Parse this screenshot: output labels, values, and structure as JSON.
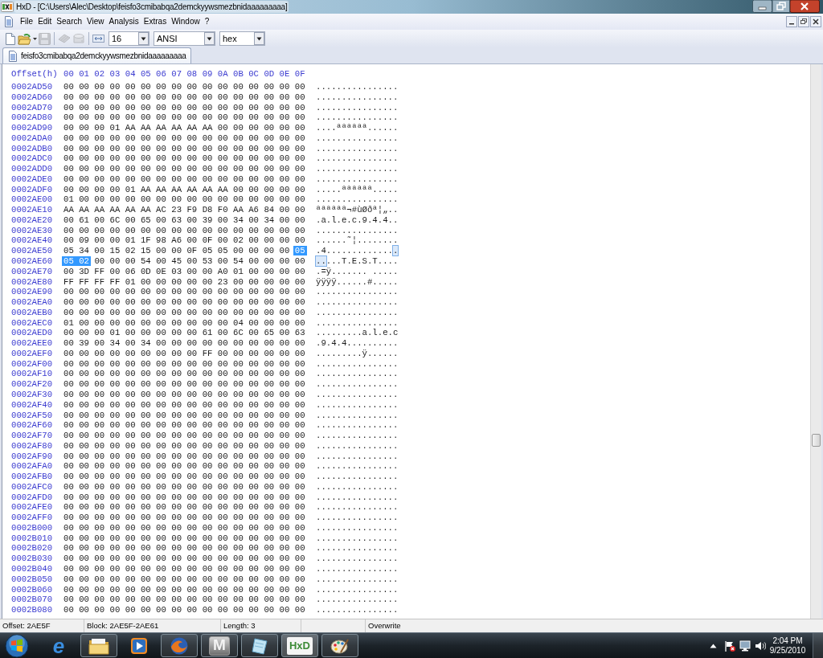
{
  "window": {
    "title": "HxD - [C:\\Users\\Alec\\Desktop\\feisfo3cmibabqa2demckyywsmezbnidaaaaaaaaa]"
  },
  "menu": [
    "File",
    "Edit",
    "Search",
    "View",
    "Analysis",
    "Extras",
    "Window",
    "?"
  ],
  "toolbar": {
    "groups": [
      [
        {
          "kind": "new",
          "disabled": false
        },
        {
          "kind": "open",
          "disabled": false
        },
        {
          "kind": "save",
          "disabled": true
        }
      ],
      [
        {
          "kind": "chip",
          "disabled": true
        },
        {
          "kind": "drive",
          "disabled": true
        }
      ],
      [
        {
          "kind": "row_width",
          "disabled": false
        }
      ]
    ],
    "dropdowns": [
      {
        "value": "16"
      },
      {
        "value": "ANSI"
      },
      {
        "value": "hex"
      }
    ]
  },
  "tabs": [
    {
      "label": "feisfo3cmibabqa2demckyywsmezbnidaaaaaaaaa",
      "selected": true
    }
  ],
  "hex_view": {
    "header": {
      "offset": "Offset(h)",
      "columns": "00 01 02 03 04 05 06 07 08 09 0A 0B 0C 0D 0E 0F"
    },
    "rows": [
      {
        "offset": "0002AD50",
        "hex": [
          {
            "text": "00 00 00 00 00 00 00 00 00 00 00 00 00 00 00 00",
            "selected": false
          }
        ],
        "ascii": [
          {
            "text": "................",
            "selected": false
          }
        ]
      },
      {
        "offset": "0002AD60",
        "hex": [
          {
            "text": "00 00 00 00 00 00 00 00 00 00 00 00 00 00 00 00",
            "selected": false
          }
        ],
        "ascii": [
          {
            "text": "................",
            "selected": false
          }
        ]
      },
      {
        "offset": "0002AD70",
        "hex": [
          {
            "text": "00 00 00 00 00 00 00 00 00 00 00 00 00 00 00 00",
            "selected": false
          }
        ],
        "ascii": [
          {
            "text": "................",
            "selected": false
          }
        ]
      },
      {
        "offset": "0002AD80",
        "hex": [
          {
            "text": "00 00 00 00 00 00 00 00 00 00 00 00 00 00 00 00",
            "selected": false
          }
        ],
        "ascii": [
          {
            "text": "................",
            "selected": false
          }
        ]
      },
      {
        "offset": "0002AD90",
        "hex": [
          {
            "text": "00 00 00 01 AA AA AA AA AA AA 00 00 00 00 00 00",
            "selected": false
          }
        ],
        "ascii": [
          {
            "text": "....ªªªªªª......",
            "selected": false
          }
        ]
      },
      {
        "offset": "0002ADA0",
        "hex": [
          {
            "text": "00 00 00 00 00 00 00 00 00 00 00 00 00 00 00 00",
            "selected": false
          }
        ],
        "ascii": [
          {
            "text": "................",
            "selected": false
          }
        ]
      },
      {
        "offset": "0002ADB0",
        "hex": [
          {
            "text": "00 00 00 00 00 00 00 00 00 00 00 00 00 00 00 00",
            "selected": false
          }
        ],
        "ascii": [
          {
            "text": "................",
            "selected": false
          }
        ]
      },
      {
        "offset": "0002ADC0",
        "hex": [
          {
            "text": "00 00 00 00 00 00 00 00 00 00 00 00 00 00 00 00",
            "selected": false
          }
        ],
        "ascii": [
          {
            "text": "................",
            "selected": false
          }
        ]
      },
      {
        "offset": "0002ADD0",
        "hex": [
          {
            "text": "00 00 00 00 00 00 00 00 00 00 00 00 00 00 00 00",
            "selected": false
          }
        ],
        "ascii": [
          {
            "text": "................",
            "selected": false
          }
        ]
      },
      {
        "offset": "0002ADE0",
        "hex": [
          {
            "text": "00 00 00 00 00 00 00 00 00 00 00 00 00 00 00 00",
            "selected": false
          }
        ],
        "ascii": [
          {
            "text": "................",
            "selected": false
          }
        ]
      },
      {
        "offset": "0002ADF0",
        "hex": [
          {
            "text": "00 00 00 00 01 AA AA AA AA AA AA 00 00 00 00 00",
            "selected": false
          }
        ],
        "ascii": [
          {
            "text": ".....ªªªªªª.....",
            "selected": false
          }
        ]
      },
      {
        "offset": "0002AE00",
        "hex": [
          {
            "text": "01 00 00 00 00 00 00 00 00 00 00 00 00 00 00 00",
            "selected": false
          }
        ],
        "ascii": [
          {
            "text": "................",
            "selected": false
          }
        ]
      },
      {
        "offset": "0002AE10",
        "hex": [
          {
            "text": "AA AA AA AA AA AA AC 23 F9 D8 F0 AA A6 84 00 00",
            "selected": false
          }
        ],
        "ascii": [
          {
            "text": "ªªªªªª¬#ùØðª¦„..",
            "selected": false
          }
        ]
      },
      {
        "offset": "0002AE20",
        "hex": [
          {
            "text": "00 61 00 6C 00 65 00 63 00 39 00 34 00 34 00 00",
            "selected": false
          }
        ],
        "ascii": [
          {
            "text": ".a.l.e.c.9.4.4..",
            "selected": false
          }
        ]
      },
      {
        "offset": "0002AE30",
        "hex": [
          {
            "text": "00 00 00 00 00 00 00 00 00 00 00 00 00 00 00 00",
            "selected": false
          }
        ],
        "ascii": [
          {
            "text": "................",
            "selected": false
          }
        ]
      },
      {
        "offset": "0002AE40",
        "hex": [
          {
            "text": "00 09 00 00 01 1F 98 A6 00 0F 00 02 00 00 00 00",
            "selected": false
          }
        ],
        "ascii": [
          {
            "text": "......˜¦........",
            "selected": false
          }
        ]
      },
      {
        "offset": "0002AE50",
        "hex": [
          {
            "text": "05 34 00 15 02 15 00 00 0F 05 05 00 00 00 00",
            "selected": false
          },
          {
            "text": "05",
            "selected": true
          }
        ],
        "ascii": [
          {
            "text": ".4.............",
            "selected": false
          },
          {
            "text": ".",
            "selected": true
          }
        ]
      },
      {
        "offset": "0002AE60",
        "hex": [
          {
            "text": "05 02",
            "selected": true
          },
          {
            "text": "00 00 00 54 00 45 00 53 00 54 00 00 00 00",
            "selected": false
          }
        ],
        "ascii": [
          {
            "text": "..",
            "selected": true
          },
          {
            "text": "...T.E.S.T....",
            "selected": false
          }
        ]
      },
      {
        "offset": "0002AE70",
        "hex": [
          {
            "text": "00 3D FF 00 06 0D 0E 03 00 00 A0 01 00 00 00 00",
            "selected": false
          }
        ],
        "ascii": [
          {
            "text": ".=ÿ....... .....",
            "selected": false
          }
        ]
      },
      {
        "offset": "0002AE80",
        "hex": [
          {
            "text": "FF FF FF FF 01 00 00 00 00 00 23 00 00 00 00 00",
            "selected": false
          }
        ],
        "ascii": [
          {
            "text": "ÿÿÿÿ......#.....",
            "selected": false
          }
        ]
      },
      {
        "offset": "0002AE90",
        "hex": [
          {
            "text": "00 00 00 00 00 00 00 00 00 00 00 00 00 00 00 00",
            "selected": false
          }
        ],
        "ascii": [
          {
            "text": "................",
            "selected": false
          }
        ]
      },
      {
        "offset": "0002AEA0",
        "hex": [
          {
            "text": "00 00 00 00 00 00 00 00 00 00 00 00 00 00 00 00",
            "selected": false
          }
        ],
        "ascii": [
          {
            "text": "................",
            "selected": false
          }
        ]
      },
      {
        "offset": "0002AEB0",
        "hex": [
          {
            "text": "00 00 00 00 00 00 00 00 00 00 00 00 00 00 00 00",
            "selected": false
          }
        ],
        "ascii": [
          {
            "text": "................",
            "selected": false
          }
        ]
      },
      {
        "offset": "0002AEC0",
        "hex": [
          {
            "text": "01 00 00 00 00 00 00 00 00 00 00 04 00 00 00 00",
            "selected": false
          }
        ],
        "ascii": [
          {
            "text": "................",
            "selected": false
          }
        ]
      },
      {
        "offset": "0002AED0",
        "hex": [
          {
            "text": "00 00 00 01 00 00 00 00 00 61 00 6C 00 65 00 63",
            "selected": false
          }
        ],
        "ascii": [
          {
            "text": ".........a.l.e.c",
            "selected": false
          }
        ]
      },
      {
        "offset": "0002AEE0",
        "hex": [
          {
            "text": "00 39 00 34 00 34 00 00 00 00 00 00 00 00 00 00",
            "selected": false
          }
        ],
        "ascii": [
          {
            "text": ".9.4.4..........",
            "selected": false
          }
        ]
      },
      {
        "offset": "0002AEF0",
        "hex": [
          {
            "text": "00 00 00 00 00 00 00 00 00 FF 00 00 00 00 00 00",
            "selected": false
          }
        ],
        "ascii": [
          {
            "text": ".........ÿ......",
            "selected": false
          }
        ]
      },
      {
        "offset": "0002AF00",
        "hex": [
          {
            "text": "00 00 00 00 00 00 00 00 00 00 00 00 00 00 00 00",
            "selected": false
          }
        ],
        "ascii": [
          {
            "text": "................",
            "selected": false
          }
        ]
      },
      {
        "offset": "0002AF10",
        "hex": [
          {
            "text": "00 00 00 00 00 00 00 00 00 00 00 00 00 00 00 00",
            "selected": false
          }
        ],
        "ascii": [
          {
            "text": "................",
            "selected": false
          }
        ]
      },
      {
        "offset": "0002AF20",
        "hex": [
          {
            "text": "00 00 00 00 00 00 00 00 00 00 00 00 00 00 00 00",
            "selected": false
          }
        ],
        "ascii": [
          {
            "text": "................",
            "selected": false
          }
        ]
      },
      {
        "offset": "0002AF30",
        "hex": [
          {
            "text": "00 00 00 00 00 00 00 00 00 00 00 00 00 00 00 00",
            "selected": false
          }
        ],
        "ascii": [
          {
            "text": "................",
            "selected": false
          }
        ]
      },
      {
        "offset": "0002AF40",
        "hex": [
          {
            "text": "00 00 00 00 00 00 00 00 00 00 00 00 00 00 00 00",
            "selected": false
          }
        ],
        "ascii": [
          {
            "text": "................",
            "selected": false
          }
        ]
      },
      {
        "offset": "0002AF50",
        "hex": [
          {
            "text": "00 00 00 00 00 00 00 00 00 00 00 00 00 00 00 00",
            "selected": false
          }
        ],
        "ascii": [
          {
            "text": "................",
            "selected": false
          }
        ]
      },
      {
        "offset": "0002AF60",
        "hex": [
          {
            "text": "00 00 00 00 00 00 00 00 00 00 00 00 00 00 00 00",
            "selected": false
          }
        ],
        "ascii": [
          {
            "text": "................",
            "selected": false
          }
        ]
      },
      {
        "offset": "0002AF70",
        "hex": [
          {
            "text": "00 00 00 00 00 00 00 00 00 00 00 00 00 00 00 00",
            "selected": false
          }
        ],
        "ascii": [
          {
            "text": "................",
            "selected": false
          }
        ]
      },
      {
        "offset": "0002AF80",
        "hex": [
          {
            "text": "00 00 00 00 00 00 00 00 00 00 00 00 00 00 00 00",
            "selected": false
          }
        ],
        "ascii": [
          {
            "text": "................",
            "selected": false
          }
        ]
      },
      {
        "offset": "0002AF90",
        "hex": [
          {
            "text": "00 00 00 00 00 00 00 00 00 00 00 00 00 00 00 00",
            "selected": false
          }
        ],
        "ascii": [
          {
            "text": "................",
            "selected": false
          }
        ]
      },
      {
        "offset": "0002AFA0",
        "hex": [
          {
            "text": "00 00 00 00 00 00 00 00 00 00 00 00 00 00 00 00",
            "selected": false
          }
        ],
        "ascii": [
          {
            "text": "................",
            "selected": false
          }
        ]
      },
      {
        "offset": "0002AFB0",
        "hex": [
          {
            "text": "00 00 00 00 00 00 00 00 00 00 00 00 00 00 00 00",
            "selected": false
          }
        ],
        "ascii": [
          {
            "text": "................",
            "selected": false
          }
        ]
      },
      {
        "offset": "0002AFC0",
        "hex": [
          {
            "text": "00 00 00 00 00 00 00 00 00 00 00 00 00 00 00 00",
            "selected": false
          }
        ],
        "ascii": [
          {
            "text": "................",
            "selected": false
          }
        ]
      },
      {
        "offset": "0002AFD0",
        "hex": [
          {
            "text": "00 00 00 00 00 00 00 00 00 00 00 00 00 00 00 00",
            "selected": false
          }
        ],
        "ascii": [
          {
            "text": "................",
            "selected": false
          }
        ]
      },
      {
        "offset": "0002AFE0",
        "hex": [
          {
            "text": "00 00 00 00 00 00 00 00 00 00 00 00 00 00 00 00",
            "selected": false
          }
        ],
        "ascii": [
          {
            "text": "................",
            "selected": false
          }
        ]
      },
      {
        "offset": "0002AFF0",
        "hex": [
          {
            "text": "00 00 00 00 00 00 00 00 00 00 00 00 00 00 00 00",
            "selected": false
          }
        ],
        "ascii": [
          {
            "text": "................",
            "selected": false
          }
        ]
      },
      {
        "offset": "0002B000",
        "hex": [
          {
            "text": "00 00 00 00 00 00 00 00 00 00 00 00 00 00 00 00",
            "selected": false
          }
        ],
        "ascii": [
          {
            "text": "................",
            "selected": false
          }
        ]
      },
      {
        "offset": "0002B010",
        "hex": [
          {
            "text": "00 00 00 00 00 00 00 00 00 00 00 00 00 00 00 00",
            "selected": false
          }
        ],
        "ascii": [
          {
            "text": "................",
            "selected": false
          }
        ]
      },
      {
        "offset": "0002B020",
        "hex": [
          {
            "text": "00 00 00 00 00 00 00 00 00 00 00 00 00 00 00 00",
            "selected": false
          }
        ],
        "ascii": [
          {
            "text": "................",
            "selected": false
          }
        ]
      },
      {
        "offset": "0002B030",
        "hex": [
          {
            "text": "00 00 00 00 00 00 00 00 00 00 00 00 00 00 00 00",
            "selected": false
          }
        ],
        "ascii": [
          {
            "text": "................",
            "selected": false
          }
        ]
      },
      {
        "offset": "0002B040",
        "hex": [
          {
            "text": "00 00 00 00 00 00 00 00 00 00 00 00 00 00 00 00",
            "selected": false
          }
        ],
        "ascii": [
          {
            "text": "................",
            "selected": false
          }
        ]
      },
      {
        "offset": "0002B050",
        "hex": [
          {
            "text": "00 00 00 00 00 00 00 00 00 00 00 00 00 00 00 00",
            "selected": false
          }
        ],
        "ascii": [
          {
            "text": "................",
            "selected": false
          }
        ]
      },
      {
        "offset": "0002B060",
        "hex": [
          {
            "text": "00 00 00 00 00 00 00 00 00 00 00 00 00 00 00 00",
            "selected": false
          }
        ],
        "ascii": [
          {
            "text": "................",
            "selected": false
          }
        ]
      },
      {
        "offset": "0002B070",
        "hex": [
          {
            "text": "00 00 00 00 00 00 00 00 00 00 00 00 00 00 00 00",
            "selected": false
          }
        ],
        "ascii": [
          {
            "text": "................",
            "selected": false
          }
        ]
      },
      {
        "offset": "0002B080",
        "hex": [
          {
            "text": "00 00 00 00 00 00 00 00 00 00 00 00 00 00 00 00",
            "selected": false
          }
        ],
        "ascii": [
          {
            "text": "................",
            "selected": false
          }
        ]
      }
    ]
  },
  "status_bar": [
    "Offset: 2AE5F",
    "Block: 2AE5F-2AE61",
    "Length: 3",
    "Overwrite"
  ],
  "taskbar": {
    "items": [
      {
        "kind": "ie",
        "label": "e",
        "running": false,
        "selected": false
      },
      {
        "kind": "folder",
        "running": true,
        "selected": false
      },
      {
        "kind": "media",
        "running": false,
        "selected": false
      },
      {
        "kind": "firefox",
        "running": true,
        "selected": false
      },
      {
        "kind": "mx",
        "label": "M",
        "running": true,
        "selected": false
      },
      {
        "kind": "page",
        "running": true,
        "selected": false
      },
      {
        "kind": "hxd",
        "label": "HxD",
        "running": true,
        "selected": true
      },
      {
        "kind": "palette",
        "running": true,
        "selected": false
      }
    ],
    "clock": {
      "time": "2:04 PM",
      "date": "9/25/2010"
    }
  }
}
